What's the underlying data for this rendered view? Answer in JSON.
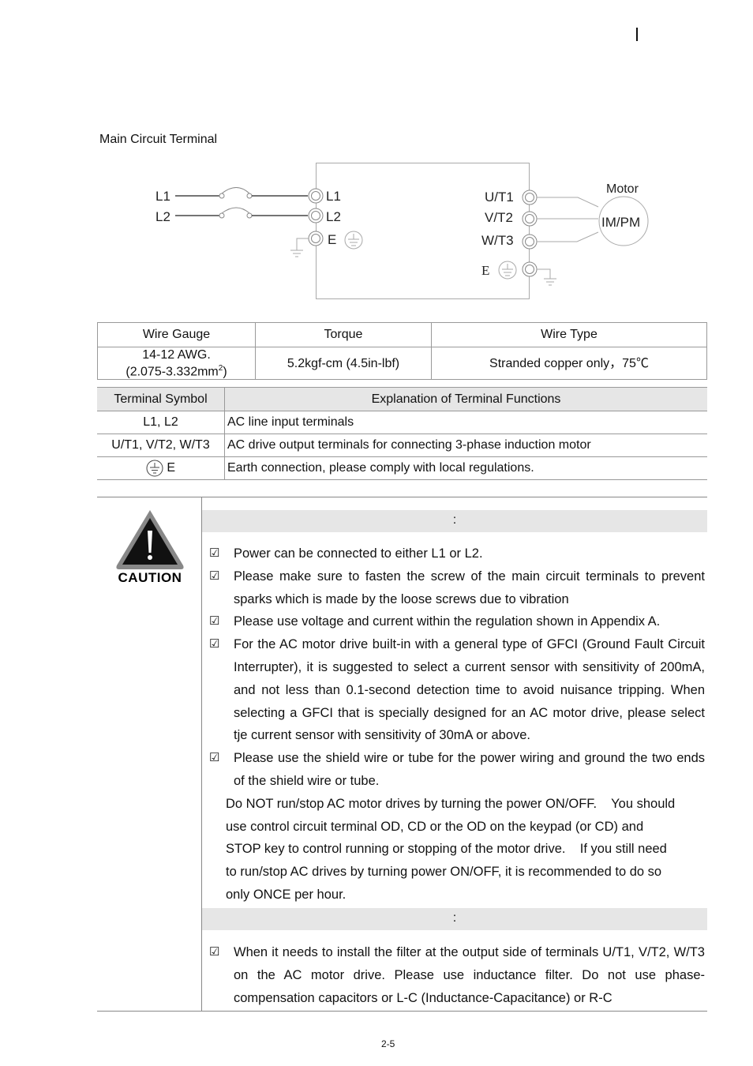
{
  "header": {
    "mark": "|"
  },
  "section_title": "Main Circuit Terminal",
  "diagram": {
    "input_labels": [
      "L1",
      "L2"
    ],
    "input_terminals": [
      "L1",
      "L2",
      "E"
    ],
    "output_terminals": [
      "U/T1",
      "V/T2",
      "W/T3",
      "E"
    ],
    "motor_label": "Motor",
    "motor_type": "IM/PM"
  },
  "spec_table": {
    "headers": [
      "Wire Gauge",
      "Torque",
      "Wire Type"
    ],
    "wire_gauge_line1": "14-12 AWG.",
    "wire_gauge_line2_pre": "(2.075-3.332mm",
    "wire_gauge_sup": "2",
    "wire_gauge_line2_post": ")",
    "torque": "5.2kgf-cm (4.5in-lbf)",
    "wire_type": "Stranded copper only，75℃"
  },
  "terminal_table": {
    "headers": [
      "Terminal Symbol",
      "Explanation of Terminal Functions"
    ],
    "rows": [
      {
        "symbol": "L1, L2",
        "explanation": "AC line input terminals"
      },
      {
        "symbol": "U/T1, V/T2, W/T3",
        "explanation": "AC drive output terminals for connecting 3-phase induction motor"
      },
      {
        "symbol": "E",
        "symbol_icon": "earth-ground-icon",
        "explanation": "Earth connection, please comply with local regulations."
      }
    ]
  },
  "caution": {
    "icon_label": "CAUTION",
    "section1_bar": ":",
    "section1_items": [
      "Power can be connected to either L1 or L2.",
      "Please make sure to fasten the screw of the main circuit terminals to prevent sparks which is made by the loose screws due to vibration",
      "Please use voltage and current within the regulation shown in Appendix A.",
      "For the AC motor drive built-in with a general type of GFCI (Ground Fault Circuit Interrupter), it is suggested to select a current sensor with sensitivity of 200mA, and not less than 0.1-second detection time to avoid nuisance tripping. When selecting a GFCI that is specially designed for an AC motor drive, please select tje current sensor with sensitivity of 30mA or above.",
      "Please use the shield wire or tube for the power wiring and ground the two ends of the shield wire or tube."
    ],
    "note_lines": [
      "Do NOT run/stop AC motor drives by turning the power ON/OFF.    You should",
      "use control circuit terminal OD, CD or the OD on the keypad (or CD) and",
      "STOP key to control running or stopping of the motor drive.    If you still need",
      "to run/stop AC drives by turning power ON/OFF, it is recommended to do so",
      "only ONCE per hour."
    ],
    "section2_bar": ":",
    "section2_items": [
      "When it needs to install the filter at the output side of terminals U/T1, V/T2, W/T3 on the AC motor drive. Please use inductance filter. Do not use phase-compensation capacitors or L-C (Inductance-Capacitance) or R-C"
    ],
    "check_glyph": "☑"
  },
  "footer": {
    "page_number": "2-5"
  }
}
